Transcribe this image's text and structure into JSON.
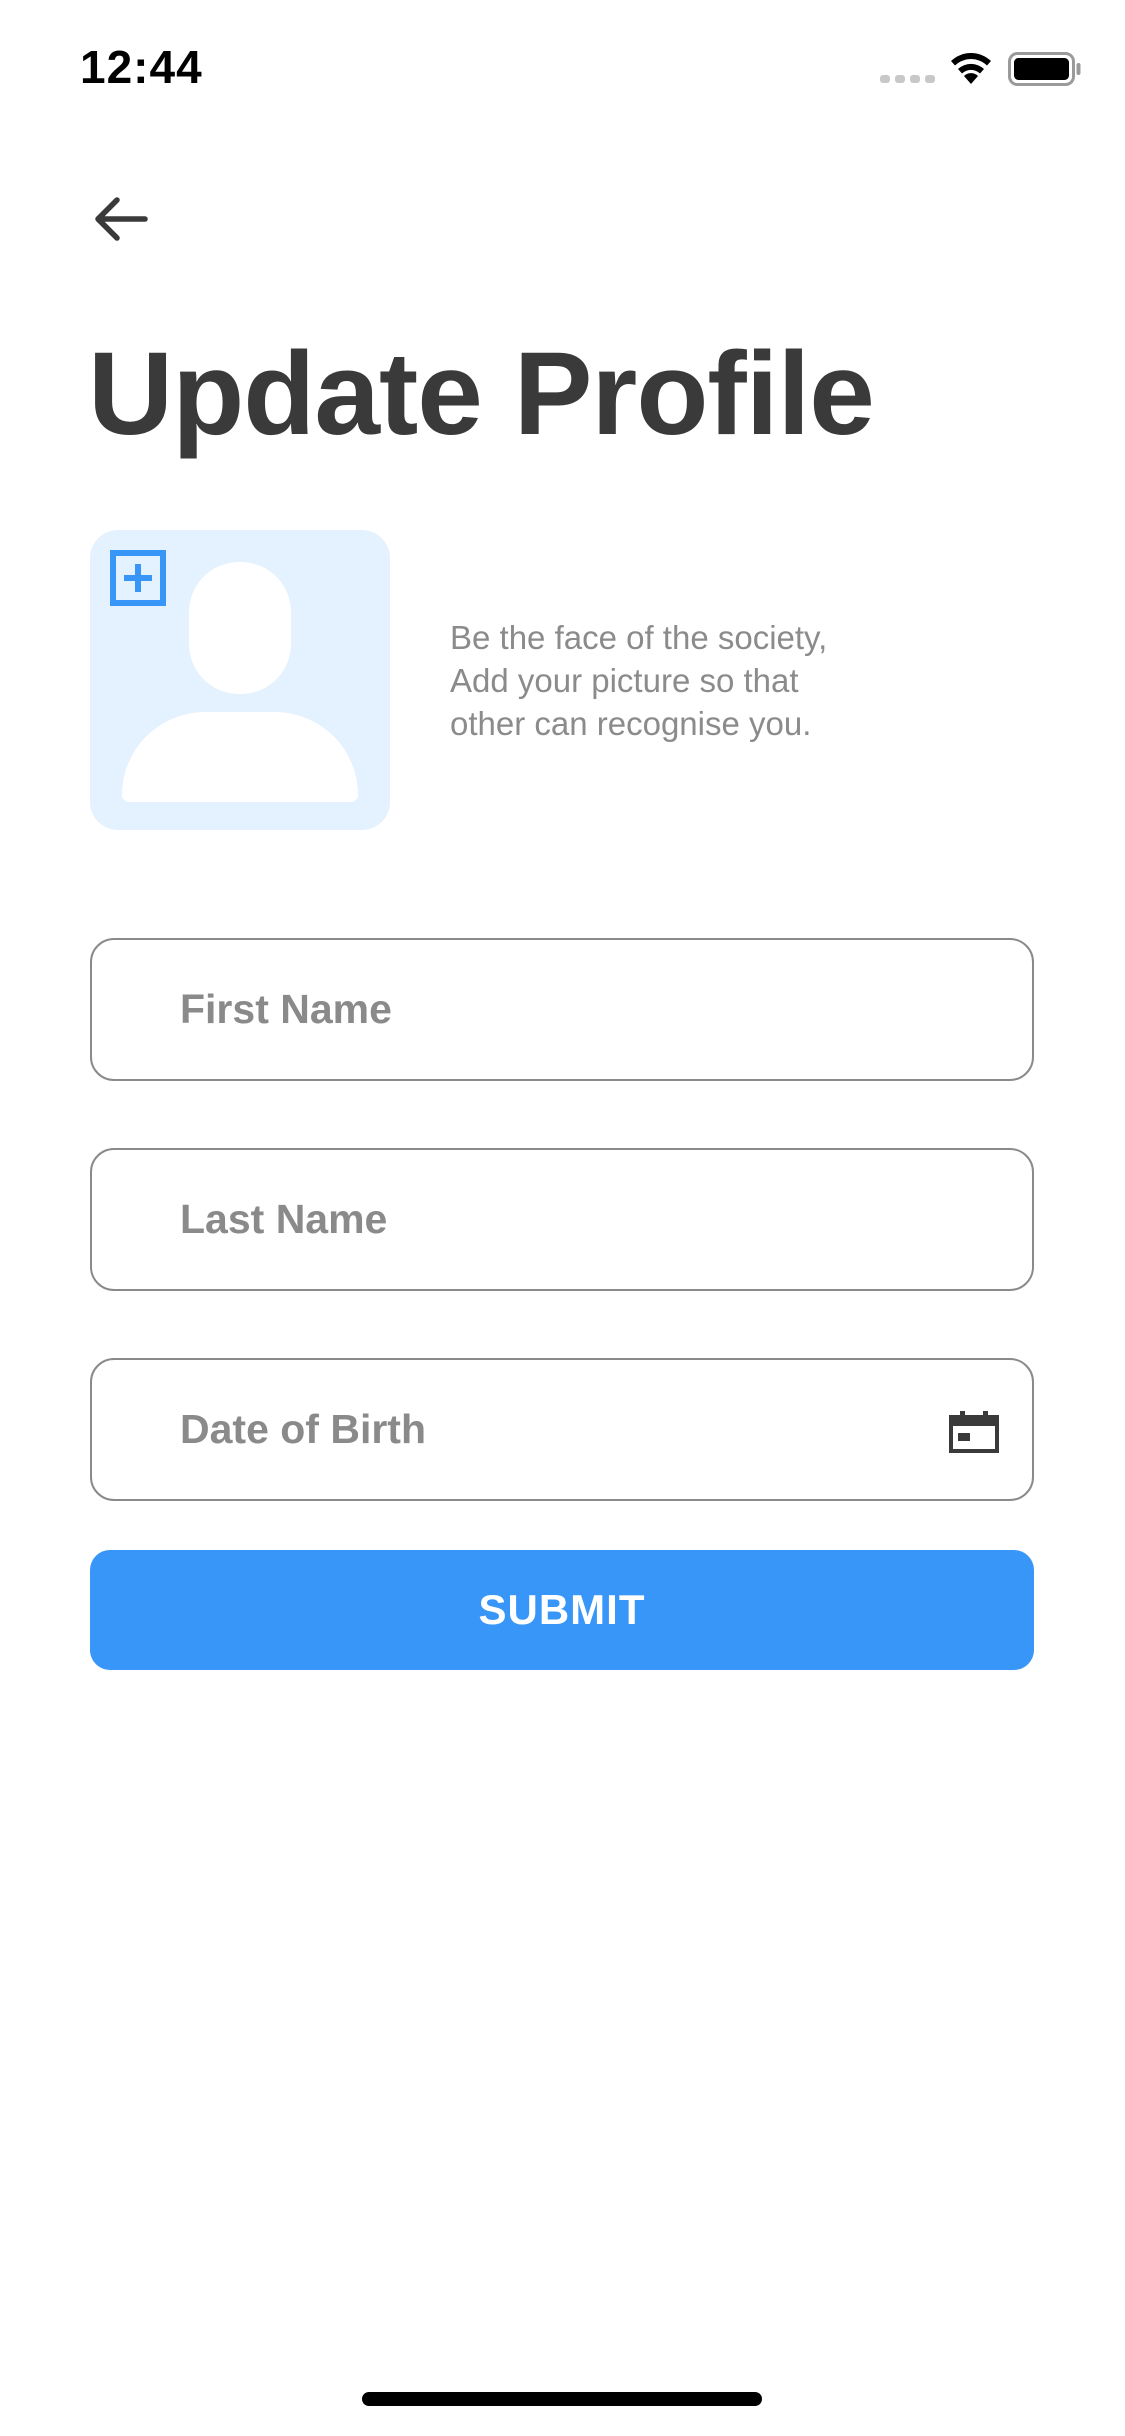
{
  "status_bar": {
    "time": "12:44",
    "signal_icon": "cellular-signal-icon",
    "wifi_icon": "wifi-icon",
    "battery_icon": "battery-icon"
  },
  "header": {
    "back_icon": "arrow-left-icon",
    "title": "Update Profile"
  },
  "avatar": {
    "add_icon": "plus-square-icon",
    "placeholder_icon": "person-silhouette-icon",
    "hint_lines": [
      "Be the face of the society,",
      "Add your picture so that",
      "other can recognise you."
    ]
  },
  "form": {
    "first_name": {
      "placeholder": "First Name",
      "value": ""
    },
    "last_name": {
      "placeholder": "Last Name",
      "value": ""
    },
    "date_of_birth": {
      "placeholder": "Date of Birth",
      "value": "",
      "icon": "calendar-icon"
    },
    "submit_label": "SUBMIT"
  },
  "colors": {
    "accent": "#3796f8",
    "avatar_background": "#e4f1fe",
    "title_text": "#3a3a3a",
    "hint_text": "#8b8b8b",
    "field_border": "#8a8a8a"
  }
}
